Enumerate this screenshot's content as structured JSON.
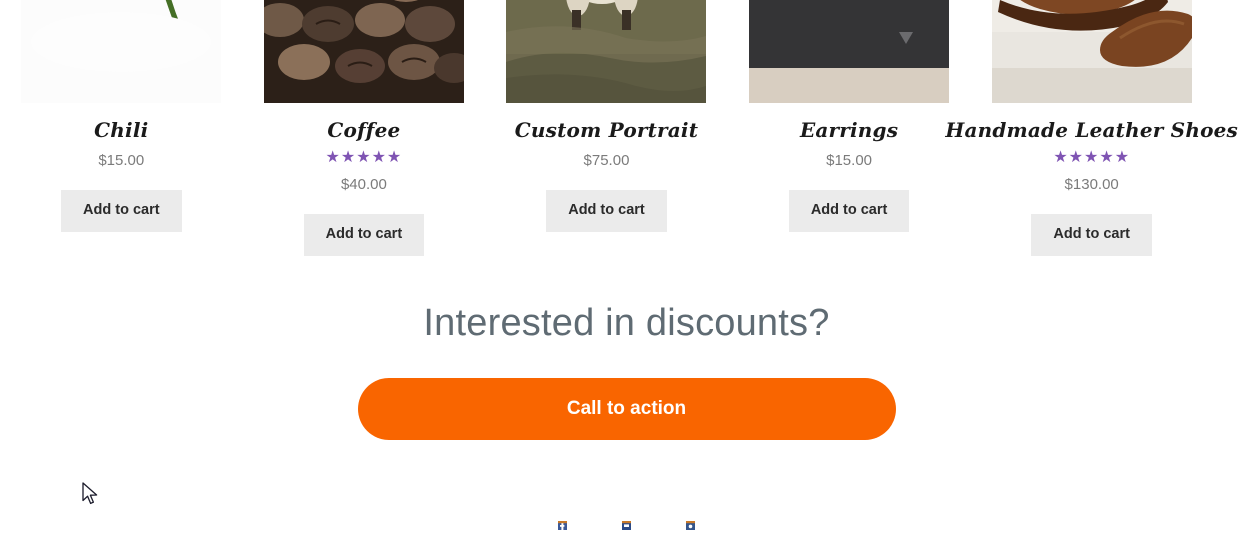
{
  "page": {
    "background_color": "#ffffff",
    "accent_star_color": "#7f54b3",
    "cta_button_color": "#f96500",
    "add_to_cart_bg_color": "#ebebeb"
  },
  "products": [
    {
      "title": "Chili",
      "price": "$15.00",
      "rating_stars": "",
      "add_to_cart_label": "Add to cart",
      "image_name": "chili-peppers-photo"
    },
    {
      "title": "Coffee",
      "price": "$40.00",
      "rating_stars": "★★★★★",
      "add_to_cart_label": "Add to cart",
      "image_name": "coffee-beans-photo"
    },
    {
      "title": "Custom Portrait",
      "price": "$75.00",
      "rating_stars": "",
      "add_to_cart_label": "Add to cart",
      "image_name": "sheep-in-field-photo"
    },
    {
      "title": "Earrings",
      "price": "$15.00",
      "rating_stars": "",
      "add_to_cart_label": "Add to cart",
      "image_name": "earrings-on-card-photo"
    },
    {
      "title": "Handmade Leather Shoes",
      "price": "$130.00",
      "rating_stars": "★★★★★",
      "add_to_cart_label": "Add to cart",
      "image_name": "brown-leather-shoes-photo"
    }
  ],
  "cta": {
    "heading": "Interested in discounts?",
    "button_label": "Call to action"
  },
  "footer": {
    "social_icons": [
      {
        "icon_name": "social-icon-1"
      },
      {
        "icon_name": "social-icon-2"
      },
      {
        "icon_name": "social-icon-3"
      }
    ]
  }
}
